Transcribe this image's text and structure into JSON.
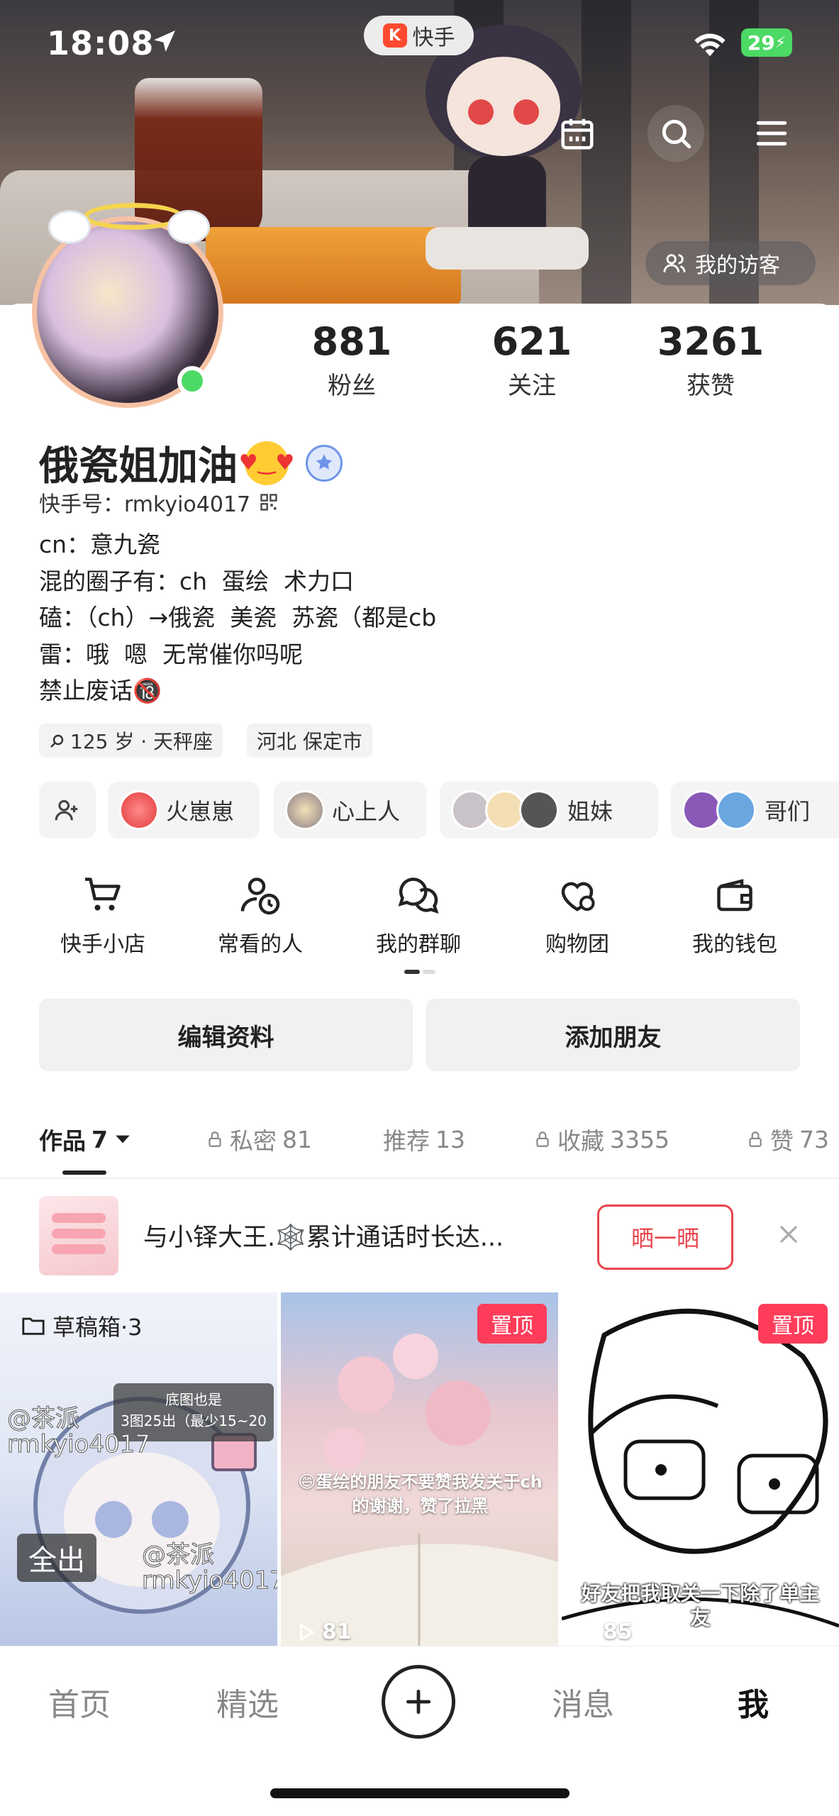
{
  "status": {
    "time": "18:08",
    "battery": "29"
  },
  "app": {
    "badge": "快手"
  },
  "header": {
    "visitor_label": "我的访客"
  },
  "stats": [
    {
      "value": "881",
      "label": "粉丝"
    },
    {
      "value": "621",
      "label": "关注"
    },
    {
      "value": "3261",
      "label": "获赞"
    }
  ],
  "profile": {
    "name": "俄瓷姐加油",
    "kuaishou_id": "快手号：rmkyio4017",
    "bio": "cn：意九瓷\n混的圈子有：ch  蛋绘  术力口\n磕：（ch）→俄瓷  美瓷  苏瓷（都是cb\n雷：哦  嗯  无常催你吗呢\n禁止废话🔞",
    "tags": [
      "125 岁 · 天秤座",
      "河北 保定市"
    ]
  },
  "friends": [
    {
      "label": "火崽崽"
    },
    {
      "label": "心上人"
    },
    {
      "label": "姐妹"
    },
    {
      "label": "哥们"
    }
  ],
  "services": [
    {
      "label": "快手小店",
      "icon": "cart-icon"
    },
    {
      "label": "常看的人",
      "icon": "person-clock-icon"
    },
    {
      "label": "我的群聊",
      "icon": "chat-bubbles-icon"
    },
    {
      "label": "购物团",
      "icon": "heart-bubble-icon"
    },
    {
      "label": "我的钱包",
      "icon": "wallet-icon"
    }
  ],
  "actions": {
    "edit": "编辑资料",
    "add_friend": "添加朋友"
  },
  "tabs": [
    {
      "label": "作品",
      "count": "7"
    },
    {
      "label": "私密",
      "count": "81"
    },
    {
      "label": "推荐",
      "count": "13"
    },
    {
      "label": "收藏",
      "count": "3355"
    },
    {
      "label": "赞",
      "count": "73"
    }
  ],
  "promo": {
    "text": "与小铎大王.🕸️累计通话时长达...",
    "button": "晒一晒"
  },
  "grid": {
    "draft_label": "草稿箱·3",
    "draft_overlay_title": "底图也是",
    "draft_overlay_sub": "3图25出（最少15~20",
    "draft_watermark": "@茶派",
    "draft_watermark_id": "rmkyio4017",
    "draft_badge": "全出",
    "pinned_label": "置顶",
    "video2_caption": "😄蛋绘的朋友不要赞我发关于ch的谢谢，赞了拉黑",
    "video2_views": "81",
    "video3_caption": "好友把我取关一下除了单主",
    "video3_caption2": "友",
    "video3_views": "85"
  },
  "bottom_nav": {
    "home": "首页",
    "featured": "精选",
    "messages": "消息",
    "me": "我"
  }
}
